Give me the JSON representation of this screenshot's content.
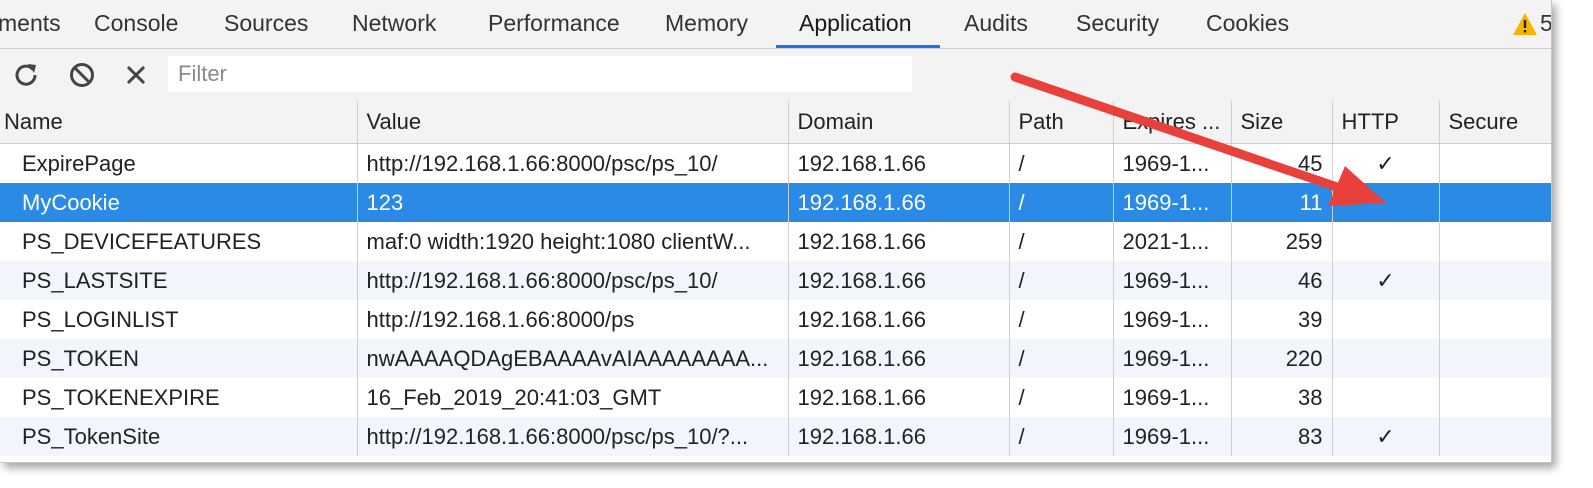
{
  "tabs": [
    {
      "label": "ments"
    },
    {
      "label": "Console"
    },
    {
      "label": "Sources"
    },
    {
      "label": "Network"
    },
    {
      "label": "Performance"
    },
    {
      "label": "Memory"
    },
    {
      "label": "Application"
    },
    {
      "label": "Audits"
    },
    {
      "label": "Security"
    },
    {
      "label": "Cookies"
    }
  ],
  "warning": {
    "icon": "warning-triangle-icon",
    "count": "5",
    "color": "#f5a623"
  },
  "toolbar": {
    "refresh_icon": "refresh-icon",
    "clear_icon": "clear-all-icon",
    "delete_icon": "delete-icon",
    "filter_placeholder": "Filter"
  },
  "table": {
    "headers": [
      "Name",
      "Value",
      "Domain",
      "Path",
      "Expires ...",
      "Size",
      "HTTP",
      "Secure"
    ],
    "rows": [
      {
        "name": "ExpirePage",
        "value": "http://192.168.1.66:8000/psc/ps_10/",
        "domain": "192.168.1.66",
        "path": "/",
        "expires": "1969-1...",
        "size": "45",
        "http": "✓",
        "secure": ""
      },
      {
        "name": "MyCookie",
        "value": "123",
        "domain": "192.168.1.66",
        "path": "/",
        "expires": "1969-1...",
        "size": "11",
        "http": "",
        "secure": ""
      },
      {
        "name": "PS_DEVICEFEATURES",
        "value": "maf:0 width:1920 height:1080 clientW...",
        "domain": "192.168.1.66",
        "path": "/",
        "expires": "2021-1...",
        "size": "259",
        "http": "",
        "secure": ""
      },
      {
        "name": "PS_LASTSITE",
        "value": "http://192.168.1.66:8000/psc/ps_10/",
        "domain": "192.168.1.66",
        "path": "/",
        "expires": "1969-1...",
        "size": "46",
        "http": "✓",
        "secure": ""
      },
      {
        "name": "PS_LOGINLIST",
        "value": "http://192.168.1.66:8000/ps",
        "domain": "192.168.1.66",
        "path": "/",
        "expires": "1969-1...",
        "size": "39",
        "http": "",
        "secure": ""
      },
      {
        "name": "PS_TOKEN",
        "value": "nwAAAAQDAgEBAAAAvAIAAAAAAAA...",
        "domain": "192.168.1.66",
        "path": "/",
        "expires": "1969-1...",
        "size": "220",
        "http": "",
        "secure": ""
      },
      {
        "name": "PS_TOKENEXPIRE",
        "value": "16_Feb_2019_20:41:03_GMT",
        "domain": "192.168.1.66",
        "path": "/",
        "expires": "1969-1...",
        "size": "38",
        "http": "",
        "secure": ""
      },
      {
        "name": "PS_TokenSite",
        "value": "http://192.168.1.66:8000/psc/ps_10/?...",
        "domain": "192.168.1.66",
        "path": "/",
        "expires": "1969-1...",
        "size": "83",
        "http": "✓",
        "secure": ""
      }
    ]
  },
  "colors": {
    "selected_row": "#2a8ae6",
    "active_tab_underline": "#1a73e8",
    "annotation_arrow": "#e8403a"
  }
}
